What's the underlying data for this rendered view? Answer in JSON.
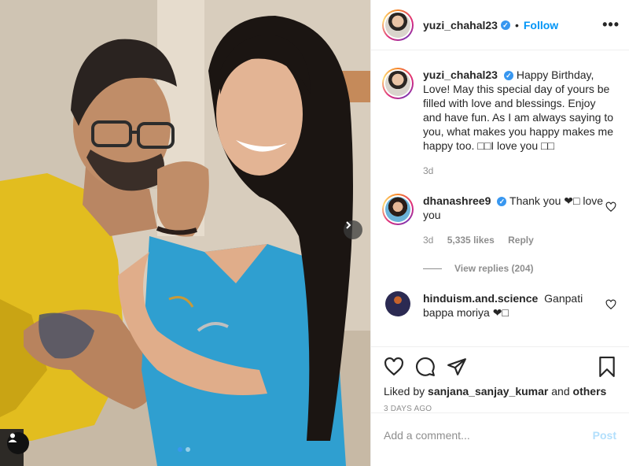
{
  "post_author": {
    "username": "yuzi_chahal23",
    "follow_label": "Follow",
    "more_label": "•••"
  },
  "caption": {
    "username": "yuzi_chahal23",
    "text": "Happy Birthday, Love! May this special day of yours be filled with love and blessings. Enjoy and have fun. As I am always saying to you, what makes you happy makes me happy too. □□I love you □□",
    "time": "3d"
  },
  "comments": [
    {
      "username": "dhanashree9",
      "text": "Thank you ❤□ love you",
      "time": "3d",
      "likes": "5,335 likes",
      "reply_label": "Reply",
      "view_replies": "View replies (204)"
    },
    {
      "username": "hinduism.and.science",
      "text": "Ganpati bappa moriya ❤□"
    }
  ],
  "likes": {
    "prefix": "Liked by",
    "user": "sanjana_sanjay_kumar",
    "connector": "and",
    "others": "others"
  },
  "timestamp": "3 DAYS AGO",
  "add_comment": {
    "placeholder": "Add a comment...",
    "post_label": "Post"
  },
  "colors": {
    "link_blue": "#0095f6",
    "verified_blue": "#3897f0",
    "muted": "#8e8e8e",
    "post_disabled": "#b2dffc"
  },
  "carousel": {
    "current": 1,
    "total": 2
  },
  "icons": [
    "verified-badge-icon",
    "more-options-icon",
    "heart-icon",
    "comment-icon",
    "share-icon",
    "bookmark-icon",
    "next-arrow-icon",
    "user-tag-icon"
  ]
}
